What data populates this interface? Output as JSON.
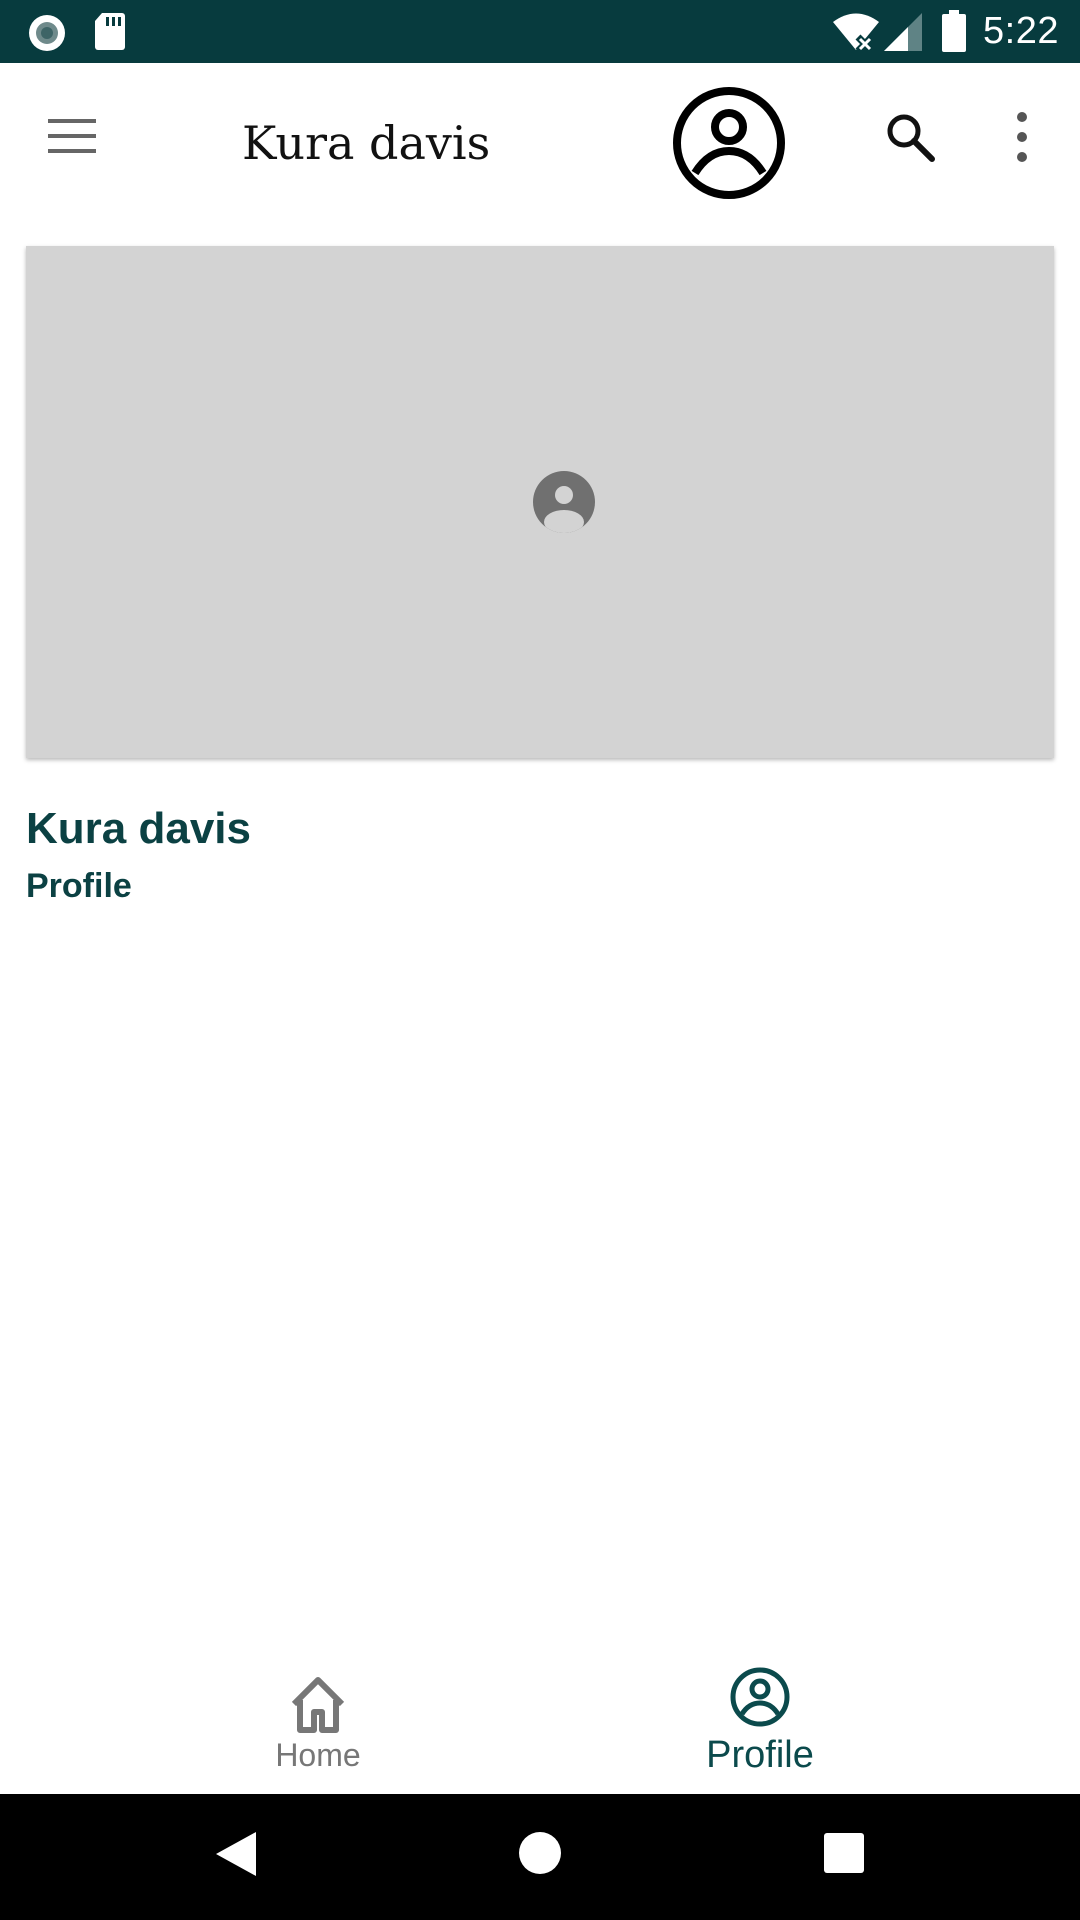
{
  "status_bar": {
    "time": "5:22",
    "background_color": "#073b3e",
    "icons": [
      "record-icon",
      "sd-card-icon",
      "wifi-icon",
      "cellular-signal-icon",
      "battery-icon"
    ]
  },
  "app_bar": {
    "title": "Kura davis",
    "menu_icon": "menu-icon",
    "avatar_icon": "account-circle-icon",
    "search_icon": "search-icon",
    "more_icon": "more-vert-icon"
  },
  "profile": {
    "cover_placeholder_icon": "person-placeholder-icon",
    "cover_color": "#d3d3d3",
    "name": "Kura davis",
    "subtitle": "Profile",
    "text_color": "#0b4143"
  },
  "bottom_nav": {
    "items": [
      {
        "label": "Home",
        "icon": "home-icon",
        "selected": false
      },
      {
        "label": "Profile",
        "icon": "account-circle-icon",
        "selected": true
      }
    ],
    "active_color": "#0b4a4c",
    "inactive_color": "#777777"
  },
  "system_nav": {
    "buttons": [
      "back-icon",
      "home-circle-icon",
      "recents-icon"
    ]
  }
}
